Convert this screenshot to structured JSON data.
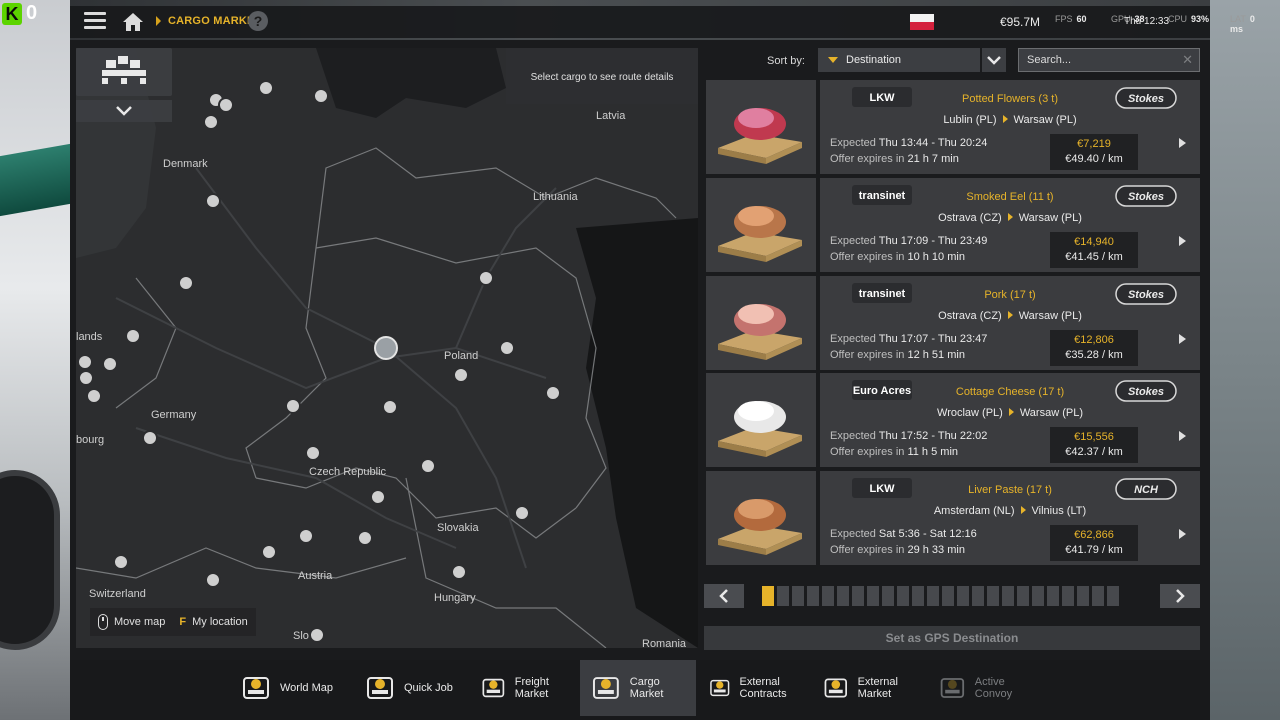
{
  "overlay": {
    "counter": "0"
  },
  "topbar": {
    "breadcrumb": "CARGO MARKET",
    "help": "?",
    "money": "€95.7M",
    "fps_label": "FPS",
    "fps_value": "60",
    "gpu_label": "GPU",
    "gpu_value": "38",
    "cpu_label": "CPU",
    "cpu_value": "93%",
    "lat_label": "LAT",
    "lat_value": "0 ms",
    "clock": "Thu 12:33"
  },
  "map": {
    "hint": "Select cargo to see route details",
    "countries": [
      "Latvia",
      "Denmark",
      "Lithuania",
      "Poland",
      "lands",
      "Germany",
      "bourg",
      "Czech Republic",
      "Slovakia",
      "Austria",
      "Switzerland",
      "Hungary",
      "Romania",
      "Slo"
    ],
    "controls": {
      "move_label": "Move map",
      "location_key": "F",
      "location_label": "My location"
    }
  },
  "sort": {
    "label": "Sort by:",
    "value": "Destination"
  },
  "search": {
    "placeholder": "Search..."
  },
  "jobs": [
    {
      "brand": "LKW",
      "client": "Stokes",
      "cargo": "Potted Flowers (3 t)",
      "from": "Lublin (PL)",
      "to": "Warsaw (PL)",
      "expected_label": "Expected",
      "expected": "Thu 13:44 - Thu 20:24",
      "offer_label": "Offer expires in",
      "offer": "21 h 7 min",
      "pay": "€7,219",
      "rate": "€49.40 / km"
    },
    {
      "brand": "transinet",
      "client": "Stokes",
      "cargo": "Smoked Eel (11 t)",
      "from": "Ostrava (CZ)",
      "to": "Warsaw (PL)",
      "expected_label": "Expected",
      "expected": "Thu 17:09 - Thu 23:49",
      "offer_label": "Offer expires in",
      "offer": "10 h 10 min",
      "pay": "€14,940",
      "rate": "€41.45 / km"
    },
    {
      "brand": "transinet",
      "client": "Stokes",
      "cargo": "Pork (17 t)",
      "from": "Ostrava (CZ)",
      "to": "Warsaw (PL)",
      "expected_label": "Expected",
      "expected": "Thu 17:07 - Thu 23:47",
      "offer_label": "Offer expires in",
      "offer": "12 h 51 min",
      "pay": "€12,806",
      "rate": "€35.28 / km"
    },
    {
      "brand": "Euro Acres",
      "client": "Stokes",
      "cargo": "Cottage Cheese (17 t)",
      "from": "Wroclaw (PL)",
      "to": "Warsaw (PL)",
      "expected_label": "Expected",
      "expected": "Thu 17:52 - Thu 22:02",
      "offer_label": "Offer expires in",
      "offer": "11 h 5 min",
      "pay": "€15,556",
      "rate": "€42.37 / km"
    },
    {
      "brand": "LKW",
      "client": "NCH",
      "cargo": "Liver Paste (17 t)",
      "from": "Amsterdam (NL)",
      "to": "Vilnius (LT)",
      "expected_label": "Expected",
      "expected": "Sat 5:36 - Sat 12:16",
      "offer_label": "Offer expires in",
      "offer": "29 h 33 min",
      "pay": "€62,866",
      "rate": "€41.79 / km"
    }
  ],
  "pager": {
    "total": 24,
    "current": 1
  },
  "gps_button": "Set as GPS Destination",
  "nav": [
    {
      "label": "World Map",
      "icon": "world-map-icon"
    },
    {
      "label": "Quick Job",
      "icon": "quick-job-icon"
    },
    {
      "label": "Freight Market",
      "icon": "freight-market-icon"
    },
    {
      "label": "Cargo Market",
      "icon": "cargo-market-icon",
      "active": true
    },
    {
      "label": "External Contracts",
      "icon": "external-contracts-icon"
    },
    {
      "label": "External Market",
      "icon": "external-market-icon"
    },
    {
      "label": "Active Convoy",
      "icon": "active-convoy-icon",
      "disabled": true
    }
  ],
  "colors": {
    "accent": "#e6b32a",
    "panel": "#3b3c3f",
    "bg": "#2c2d2f"
  }
}
